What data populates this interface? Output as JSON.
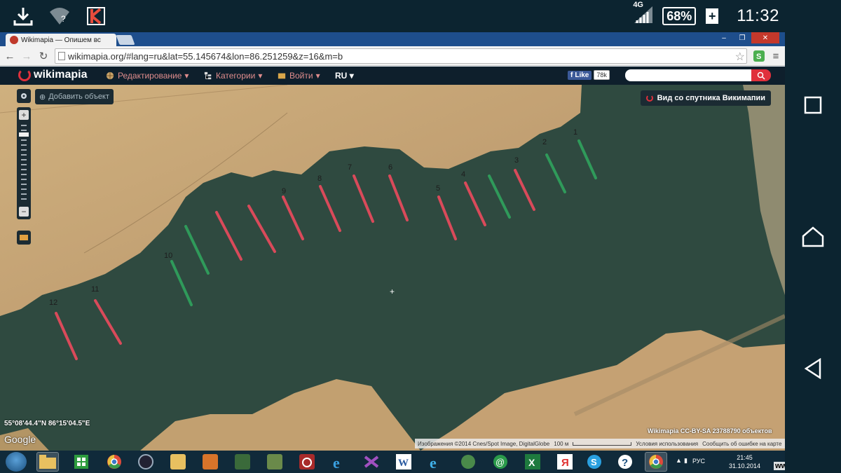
{
  "status_bar": {
    "network": "4G",
    "battery": "68%",
    "time": "11:32",
    "icons": [
      "download-icon",
      "wifi-question-icon",
      "kaspersky-icon",
      "signal-icon",
      "battery-icon"
    ]
  },
  "browser": {
    "tab_title": "Wikimapia — Опишем вс",
    "url": "wikimapia.org/#lang=ru&lat=55.145674&lon=86.251259&z=16&m=b",
    "window_controls": [
      "–",
      "❐",
      "✕"
    ]
  },
  "wikimapia": {
    "logo": "wikimapia",
    "menu": [
      {
        "label": "Редактирование",
        "icon": "globe-icon"
      },
      {
        "label": "Категории",
        "icon": "tree-icon"
      },
      {
        "label": "Войти",
        "icon": "login-icon"
      }
    ],
    "language": "RU",
    "fb_like": "Like",
    "fb_count": "78k",
    "add_object": "Добавить объект",
    "satellite_view": "Вид со спутника Викимапии"
  },
  "map": {
    "markers": [
      {
        "n": "1",
        "color": "green"
      },
      {
        "n": "2",
        "color": "green"
      },
      {
        "n": "3",
        "color": "red"
      },
      {
        "n": "4",
        "color": "green"
      },
      {
        "n": "5",
        "color": "red"
      },
      {
        "n": "6",
        "color": "red"
      },
      {
        "n": "7",
        "color": "red"
      },
      {
        "n": "8",
        "color": "red"
      },
      {
        "n": "9",
        "color": "red"
      },
      {
        "n": "10",
        "color": "green"
      },
      {
        "n": "11",
        "color": "red"
      },
      {
        "n": "12",
        "color": "red"
      }
    ],
    "colors": {
      "red": "#d94a5a",
      "green": "#2f9a5a",
      "water": "#2f4a40",
      "land": "#c9a574"
    },
    "coords": "55°08'44.4\"N 86°15'04.5\"E",
    "google": "Google",
    "wm_license": "Wikimapia CC-BY-SA 23788790 объектов",
    "attribution": "Изображения ©2014 Cnes/Spot Image, DigitalGlobe",
    "scale": "100 м",
    "terms": "Условия использования",
    "report": "Сообщить об ошибке на карте"
  },
  "taskbar": {
    "language": "РУС",
    "time": "21:45",
    "date": "31.10.2014",
    "watermark": "www.tugun.ru"
  }
}
